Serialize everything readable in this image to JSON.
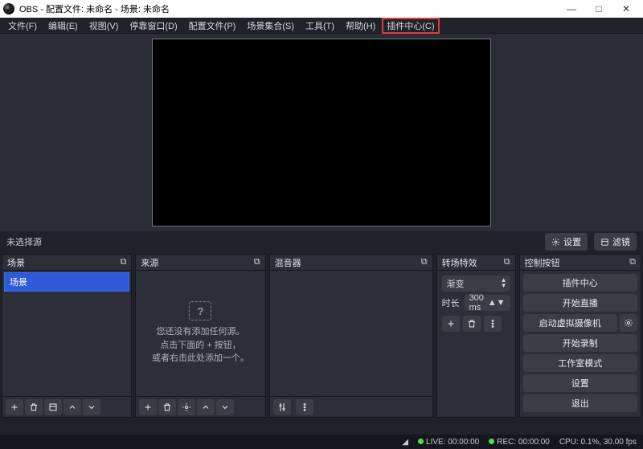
{
  "title": "OBS      - 配置文件: 未命名 - 场景: 未命名",
  "window": {
    "min": "—",
    "max": "□",
    "close": "✕"
  },
  "menu": [
    {
      "label": "文件(F)",
      "name": "menu-file"
    },
    {
      "label": "编辑(E)",
      "name": "menu-edit"
    },
    {
      "label": "视图(V)",
      "name": "menu-view"
    },
    {
      "label": "停靠窗口(D)",
      "name": "menu-dock"
    },
    {
      "label": "配置文件(P)",
      "name": "menu-profile"
    },
    {
      "label": "场景集合(S)",
      "name": "menu-scene-collection"
    },
    {
      "label": "工具(T)",
      "name": "menu-tools"
    },
    {
      "label": "帮助(H)",
      "name": "menu-help"
    },
    {
      "label": "插件中心(C)",
      "name": "menu-plugin-center",
      "highlight": true
    }
  ],
  "no_source_label": "未选择源",
  "btn_properties": "设置",
  "btn_filters": "滤镜",
  "docks": {
    "scenes": {
      "title": "场景",
      "item": "场景"
    },
    "sources": {
      "title": "来源",
      "empty1": "您还没有添加任何源。",
      "empty2": "点击下面的 + 按钮，",
      "empty3": "或者右击此处添加一个。"
    },
    "mixer": {
      "title": "混音器"
    },
    "transitions": {
      "title": "转场特效",
      "type": "渐变",
      "dur_label": "时长",
      "dur_value": "300 ms"
    },
    "controls": {
      "title": "控制按钮",
      "plugin_center": "插件中心",
      "start_stream": "开始直播",
      "start_vcam": "启动虚拟摄像机",
      "start_record": "开始录制",
      "studio_mode": "工作室模式",
      "settings": "设置",
      "exit": "退出"
    }
  },
  "status": {
    "live": "LIVE: 00:00:00",
    "rec": "REC: 00:00:00",
    "cpu": "CPU: 0.1%, 30.00 fps"
  }
}
